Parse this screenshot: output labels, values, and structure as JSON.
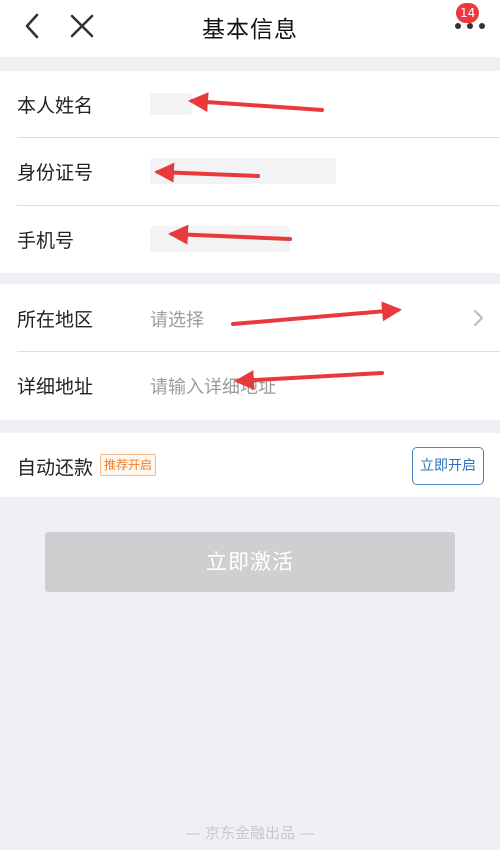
{
  "navbar": {
    "title": "基本信息",
    "badge_count": "14",
    "icons": {
      "back": "chevron-left-icon",
      "close": "close-icon",
      "more": "more-dots-icon"
    }
  },
  "identity": {
    "name_label": "本人姓名",
    "id_label": "身份证号",
    "phone_label": "手机号"
  },
  "address": {
    "region_label": "所在地区",
    "region_placeholder": "请选择",
    "detail_label": "详细地址",
    "detail_placeholder": "请输入详细地址"
  },
  "repay": {
    "label": "自动还款",
    "tag": "推荐开启",
    "button": "立即开启"
  },
  "activate_button": "立即激活",
  "footer": "— 京东金融出品 —",
  "colors": {
    "annotation_arrow": "#e8393c",
    "badge": "#f0373b",
    "link_blue": "#2f6fbf",
    "tag_orange": "#ef7c2a",
    "disabled_button": "#cfcfd2"
  }
}
